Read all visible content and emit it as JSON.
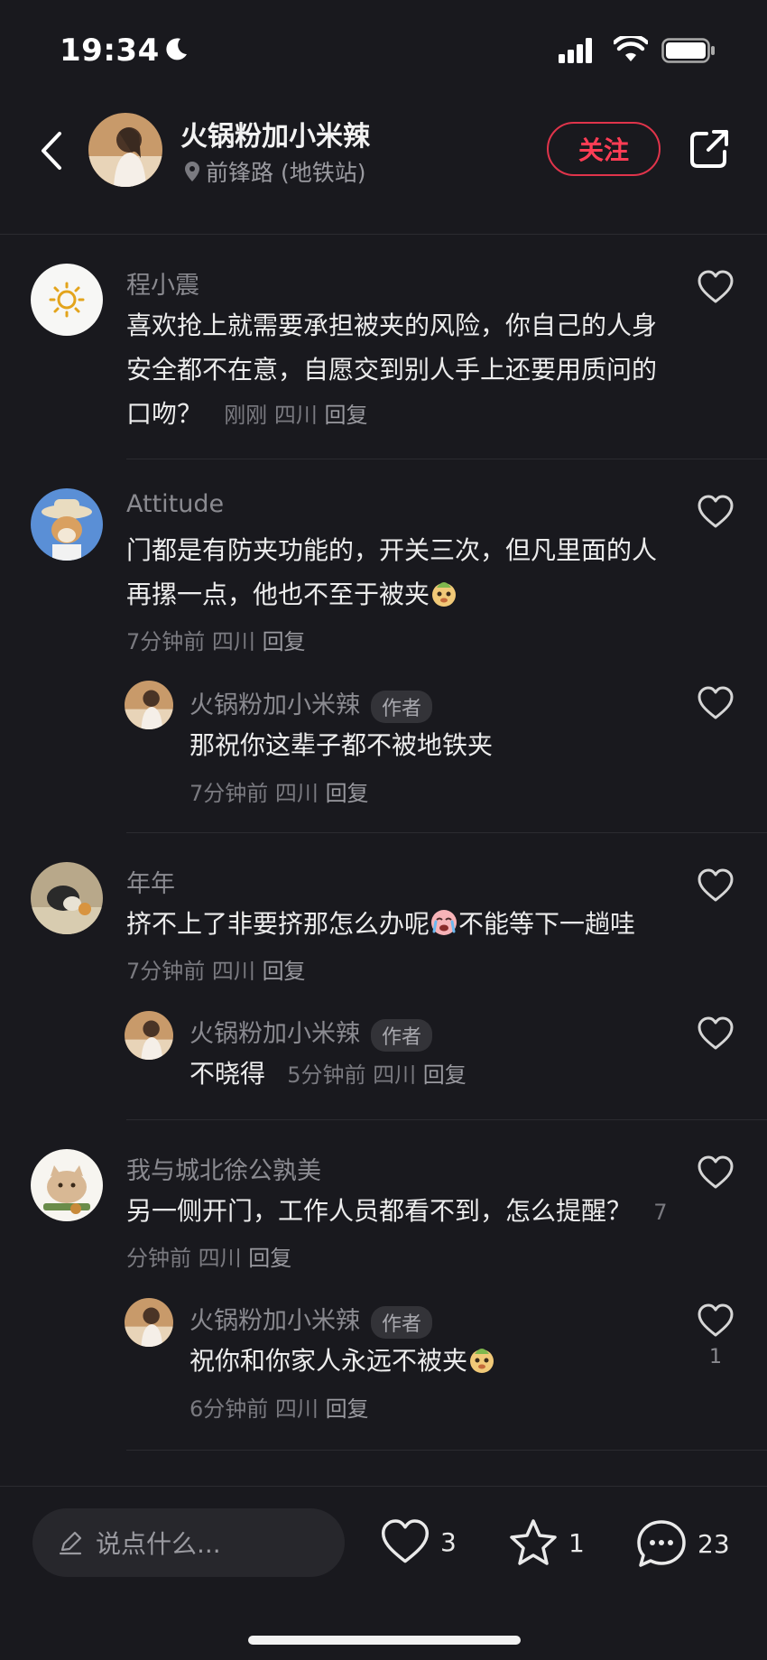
{
  "status_bar": {
    "time": "19:34"
  },
  "header": {
    "author_name": "火锅粉加小米辣",
    "location": "前锋路 (地铁站)",
    "follow_label": "关注"
  },
  "comments": [
    {
      "user": "程小震",
      "text": "喜欢抢上就需要承担被夹的风险，你自己的人身安全都不在意，自愿交到别人手上还要用质问的口吻？",
      "time": "刚刚",
      "region": "四川",
      "reply": "回复"
    },
    {
      "user": "Attitude",
      "text": "门都是有防夹功能的，开关三次，但凡里面的人再摞一点，他也不至于被夹",
      "time": "7分钟前",
      "region": "四川",
      "reply": "回复",
      "replies": [
        {
          "user": "火锅粉加小米辣",
          "badge": "作者",
          "text": "那祝你这辈子都不被地铁夹",
          "time": "7分钟前",
          "region": "四川",
          "reply": "回复"
        }
      ]
    },
    {
      "user": "年年",
      "text": "挤不上了非要挤那怎么办呢",
      "text2": "不能等下一趟哇",
      "time": "7分钟前",
      "region": "四川",
      "reply": "回复",
      "replies": [
        {
          "user": "火锅粉加小米辣",
          "badge": "作者",
          "text": "不晓得",
          "time": "5分钟前",
          "region": "四川",
          "reply": "回复"
        }
      ]
    },
    {
      "user": "我与城北徐公孰美",
      "text": "另一侧开门，工作人员都看不到，怎么提醒？",
      "time": "7分钟前",
      "region": "四川",
      "reply": "回复",
      "replies": [
        {
          "user": "火锅粉加小米辣",
          "badge": "作者",
          "text": "祝你和你家人永远不被夹",
          "time": "6分钟前",
          "region": "四川",
          "reply": "回复",
          "likes": "1"
        }
      ]
    }
  ],
  "bottom_bar": {
    "input_placeholder": "说点什么...",
    "likes": "3",
    "stars": "1",
    "comments": "23"
  },
  "colors": {
    "background": "#19191e",
    "accent": "#ff3d55",
    "text": "#ececec",
    "muted": "#8a8a90"
  }
}
